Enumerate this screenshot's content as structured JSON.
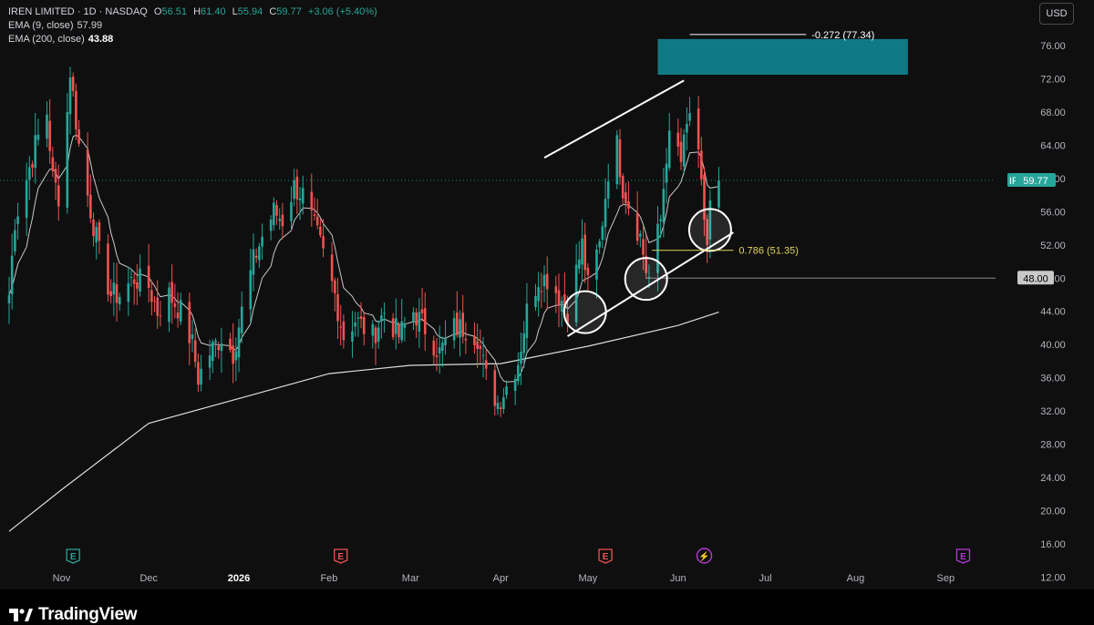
{
  "header": {
    "symbol": "IREN LIMITED",
    "interval": "1D",
    "exchange": "NASDAQ",
    "ohlc": [
      {
        "label": "O",
        "value": "56.51"
      },
      {
        "label": "H",
        "value": "61.40"
      },
      {
        "label": "L",
        "value": "55.94"
      },
      {
        "label": "C",
        "value": "59.77"
      }
    ],
    "change": "+3.06 (+5.40%)",
    "ema9_label": "EMA (9, close)",
    "ema9_value": "57.99",
    "ema200_label": "EMA (200, close)",
    "ema200_value": "43.88"
  },
  "currency_button": "USD",
  "brand_name": "TradingView",
  "colors": {
    "up": "#26a69a",
    "down": "#ef5350",
    "ema": "#c8c8c8",
    "zone": "#0f7a85",
    "fib": "#e2d45a",
    "earnings_green": "#26a69a",
    "earnings_red": "#ef5350",
    "event_purple": "#b33ad6"
  },
  "chart_data": {
    "type": "candlestick",
    "y_axis": {
      "range": [
        10.5,
        81.5
      ],
      "ticks": [
        80,
        76,
        72,
        68,
        64,
        60,
        56,
        52,
        48,
        44,
        40,
        36,
        32,
        28,
        24,
        20,
        16,
        12
      ],
      "tick_labels": [
        "80.00",
        "76.00",
        "72.00",
        "68.00",
        "64.00",
        "60.00",
        "56.00",
        "52.00",
        "48.00",
        "44.00",
        "40.00",
        "36.00",
        "32.00",
        "28.00",
        "24.00",
        "20.00",
        "16.00",
        "12.00"
      ],
      "side": "right"
    },
    "x_axis": {
      "start_date": "2025-10-14",
      "end_date": "2026-09-15",
      "ticks": [
        {
          "date": "2025-11-01",
          "label": "Nov"
        },
        {
          "date": "2025-12-01",
          "label": "Dec"
        },
        {
          "date": "2026-01-01",
          "label": "2026"
        },
        {
          "date": "2026-02-01",
          "label": "Feb"
        },
        {
          "date": "2026-03-01",
          "label": "Mar"
        },
        {
          "date": "2026-04-01",
          "label": "Apr"
        },
        {
          "date": "2026-05-01",
          "label": "May"
        },
        {
          "date": "2026-06-01",
          "label": "Jun"
        },
        {
          "date": "2026-07-01",
          "label": "Jul"
        },
        {
          "date": "2026-08-01",
          "label": "Aug"
        },
        {
          "date": "2026-09-01",
          "label": "Sep"
        }
      ]
    },
    "price_path": [
      {
        "date": "2025-10-14",
        "close": 46
      },
      {
        "date": "2025-10-16",
        "close": 55
      },
      {
        "date": "2025-10-20",
        "close": 60
      },
      {
        "date": "2025-10-23",
        "close": 64
      },
      {
        "date": "2025-10-27",
        "close": 68
      },
      {
        "date": "2025-10-29",
        "close": 60
      },
      {
        "date": "2025-11-01",
        "close": 57
      },
      {
        "date": "2025-11-03",
        "close": 68
      },
      {
        "date": "2025-11-04",
        "close": 73
      },
      {
        "date": "2025-11-07",
        "close": 64
      },
      {
        "date": "2025-11-10",
        "close": 58
      },
      {
        "date": "2025-11-14",
        "close": 51
      },
      {
        "date": "2025-11-18",
        "close": 46
      },
      {
        "date": "2025-11-21",
        "close": 46
      },
      {
        "date": "2025-11-26",
        "close": 48
      },
      {
        "date": "2025-12-01",
        "close": 47
      },
      {
        "date": "2025-12-04",
        "close": 44
      },
      {
        "date": "2025-12-08",
        "close": 46
      },
      {
        "date": "2025-12-12",
        "close": 44
      },
      {
        "date": "2025-12-16",
        "close": 40
      },
      {
        "date": "2025-12-18",
        "close": 36
      },
      {
        "date": "2025-12-22",
        "close": 39
      },
      {
        "date": "2025-12-26",
        "close": 41
      },
      {
        "date": "2025-12-30",
        "close": 39
      },
      {
        "date": "2026-01-02",
        "close": 44
      },
      {
        "date": "2026-01-06",
        "close": 50
      },
      {
        "date": "2026-01-09",
        "close": 53
      },
      {
        "date": "2026-01-13",
        "close": 56
      },
      {
        "date": "2026-01-16",
        "close": 55
      },
      {
        "date": "2026-01-20",
        "close": 59
      },
      {
        "date": "2026-01-23",
        "close": 58
      },
      {
        "date": "2026-01-26",
        "close": 55
      },
      {
        "date": "2026-01-29",
        "close": 52
      },
      {
        "date": "2026-02-03",
        "close": 46
      },
      {
        "date": "2026-02-06",
        "close": 41
      },
      {
        "date": "2026-02-10",
        "close": 43
      },
      {
        "date": "2026-02-16",
        "close": 41
      },
      {
        "date": "2026-02-20",
        "close": 44
      },
      {
        "date": "2026-02-25",
        "close": 41
      },
      {
        "date": "2026-03-02",
        "close": 44
      },
      {
        "date": "2026-03-06",
        "close": 42
      },
      {
        "date": "2026-03-11",
        "close": 39
      },
      {
        "date": "2026-03-16",
        "close": 42
      },
      {
        "date": "2026-03-20",
        "close": 42
      },
      {
        "date": "2026-03-24",
        "close": 41
      },
      {
        "date": "2026-03-27",
        "close": 36
      },
      {
        "date": "2026-03-31",
        "close": 33
      },
      {
        "date": "2026-04-03",
        "close": 35
      },
      {
        "date": "2026-04-07",
        "close": 38
      },
      {
        "date": "2026-04-10",
        "close": 44
      },
      {
        "date": "2026-04-14",
        "close": 48
      },
      {
        "date": "2026-04-17",
        "close": 48
      },
      {
        "date": "2026-04-21",
        "close": 46
      },
      {
        "date": "2026-04-24",
        "close": 44
      },
      {
        "date": "2026-04-29",
        "close": 52
      },
      {
        "date": "2026-05-01",
        "close": 47
      },
      {
        "date": "2026-05-05",
        "close": 52
      },
      {
        "date": "2026-05-08",
        "close": 61
      },
      {
        "date": "2026-05-11",
        "close": 64
      },
      {
        "date": "2026-05-13",
        "close": 59
      },
      {
        "date": "2026-05-16",
        "close": 56
      },
      {
        "date": "2026-05-19",
        "close": 53
      },
      {
        "date": "2026-05-21",
        "close": 49
      },
      {
        "date": "2026-05-22",
        "close": 48
      },
      {
        "date": "2026-05-26",
        "close": 55
      },
      {
        "date": "2026-05-28",
        "close": 63
      },
      {
        "date": "2026-05-30",
        "close": 66
      },
      {
        "date": "2026-06-02",
        "close": 62
      },
      {
        "date": "2026-06-05",
        "close": 68
      },
      {
        "date": "2026-06-08",
        "close": 62
      },
      {
        "date": "2026-06-11",
        "close": 52
      },
      {
        "date": "2026-06-12",
        "close": 56.7
      },
      {
        "date": "2026-06-15",
        "close": 59.8
      }
    ],
    "ema200_path": [
      {
        "date": "2025-10-14",
        "value": 17.5
      },
      {
        "date": "2025-11-01",
        "value": 22.5
      },
      {
        "date": "2025-12-01",
        "value": 30.5
      },
      {
        "date": "2026-01-01",
        "value": 33.5
      },
      {
        "date": "2026-02-01",
        "value": 36.5
      },
      {
        "date": "2026-03-01",
        "value": 37.5
      },
      {
        "date": "2026-04-01",
        "value": 37.7
      },
      {
        "date": "2026-05-01",
        "value": 39.8
      },
      {
        "date": "2026-06-01",
        "value": 42.3
      },
      {
        "date": "2026-06-15",
        "value": 43.9
      }
    ],
    "current_price": {
      "label": "IREN",
      "value": 59.77,
      "text": "59.77"
    },
    "horizontal_level": {
      "value": 48,
      "text": "48.00"
    },
    "fib_levels": [
      {
        "text": "-0.272 (77.34)",
        "value": 77.34,
        "from": "2026-06-05",
        "to": "2026-07-15"
      },
      {
        "text": "0.786 (51.35)",
        "value": 51.35,
        "from": "2026-05-23",
        "to": "2026-06-20"
      }
    ],
    "target_zone": {
      "from_date": "2026-05-25",
      "to_date": "2026-08-19",
      "low": 72.5,
      "high": 76.8
    },
    "trendlines": [
      {
        "name": "upper-channel-line",
        "from": {
          "date": "2026-04-16",
          "value": 62.5
        },
        "to": {
          "date": "2026-06-03",
          "value": 71.8
        }
      },
      {
        "name": "lower-channel-line",
        "from": {
          "date": "2026-04-24",
          "value": 41.0
        },
        "to": {
          "date": "2026-06-20",
          "value": 53.5
        }
      }
    ],
    "circles": [
      {
        "date": "2026-04-30",
        "value": 43.9
      },
      {
        "date": "2026-05-21",
        "value": 47.9
      },
      {
        "date": "2026-06-12",
        "value": 53.8
      }
    ],
    "events": [
      {
        "date": "2025-11-05",
        "type": "earnings",
        "color": "green",
        "glyph": "E"
      },
      {
        "date": "2026-02-05",
        "type": "earnings",
        "color": "red",
        "glyph": "E"
      },
      {
        "date": "2026-05-07",
        "type": "earnings",
        "color": "red",
        "glyph": "E"
      },
      {
        "date": "2026-06-10",
        "type": "split",
        "color": "purple",
        "glyph": "⚡"
      },
      {
        "date": "2026-09-07",
        "type": "earnings",
        "color": "purple",
        "glyph": "E"
      }
    ]
  }
}
